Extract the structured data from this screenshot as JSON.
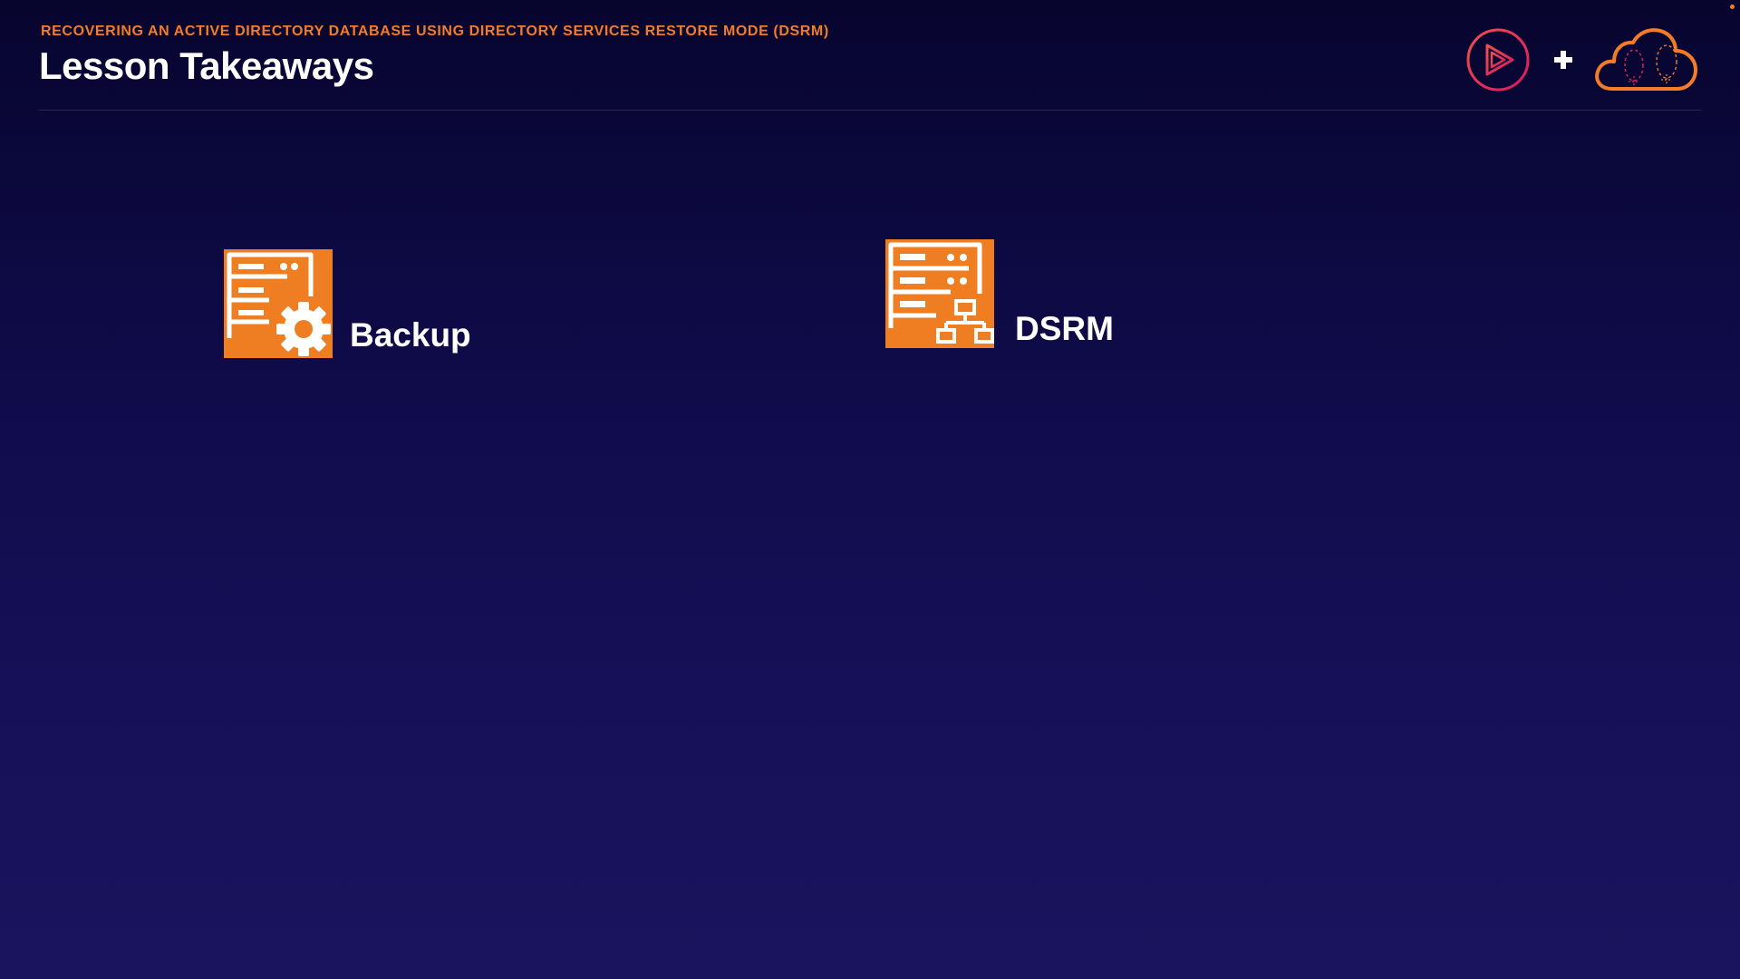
{
  "header": {
    "course_title": "RECOVERING AN ACTIVE DIRECTORY DATABASE USING DIRECTORY SERVICES RESTORE MODE (DSRM)",
    "lesson_title": "Lesson Takeaways"
  },
  "brand": {
    "play_logo_icon": "pluralsight-play-icon",
    "plus_icon": "plus-icon",
    "cloud_logo_icon": "acg-cloud-icon",
    "colors": {
      "play_ring": "#e0245e",
      "cloud": "#f37b29"
    }
  },
  "takeaways": [
    {
      "label": "Backup",
      "icon": "server-gear-icon"
    },
    {
      "label": "DSRM",
      "icon": "server-network-icon"
    }
  ],
  "colors": {
    "accent": "#f37b29",
    "tile": "#ef7d22",
    "background_top": "#07052e",
    "background_bottom": "#1a145e"
  }
}
